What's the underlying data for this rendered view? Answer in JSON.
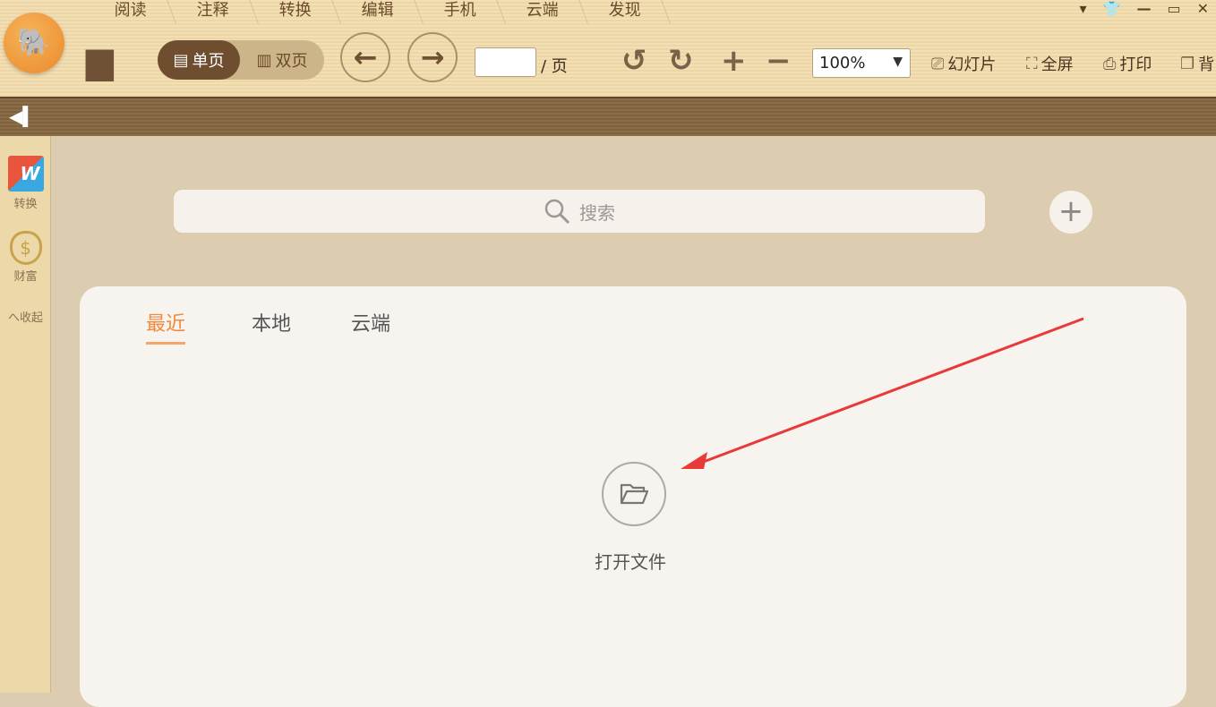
{
  "menu_tabs": [
    "阅读",
    "注释",
    "转换",
    "编辑",
    "手机",
    "云端",
    "发现"
  ],
  "toolbar": {
    "single_page": "单页",
    "double_page": "双页",
    "page_suffix": "/ 页",
    "page_value": "",
    "zoom": "100%",
    "slideshow": "幻灯片",
    "fullscreen": "全屏",
    "print": "打印",
    "more": "背"
  },
  "sidebar": {
    "convert": "转换",
    "wealth": "财富",
    "collapse": "へ收起"
  },
  "search": {
    "placeholder": "搜索"
  },
  "panel": {
    "tabs": [
      "最近",
      "本地",
      "云端"
    ],
    "open_file": "打开文件"
  },
  "colors": {
    "accent": "#f08a3c",
    "arrow": "#e83a3a"
  }
}
